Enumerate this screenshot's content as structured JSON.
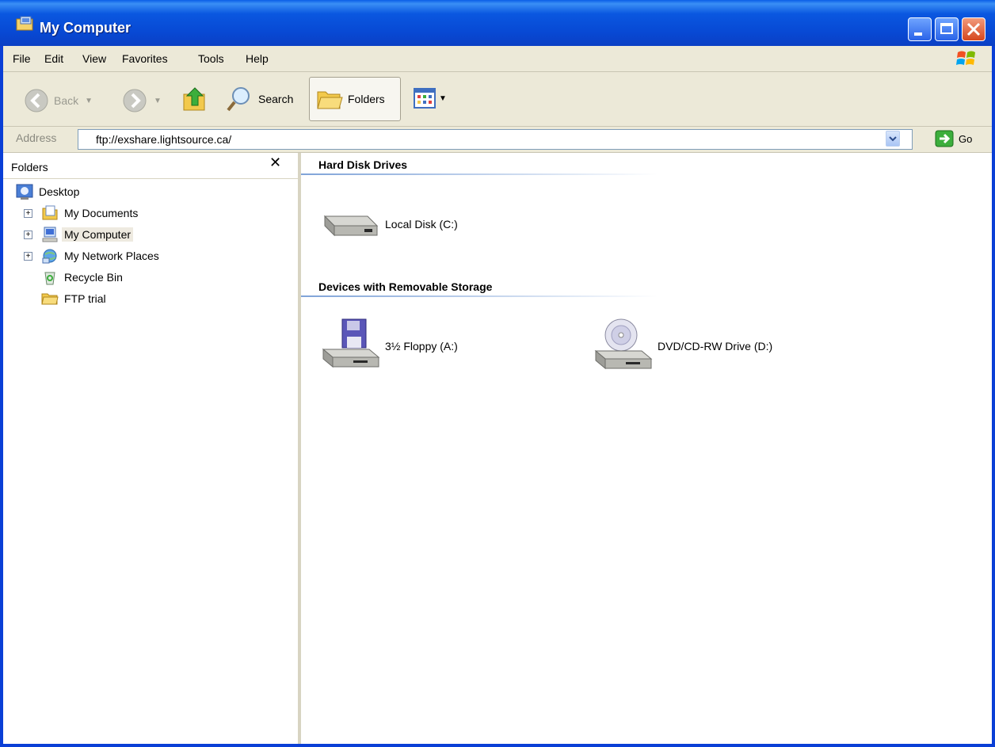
{
  "window": {
    "title": "My Computer"
  },
  "menu": {
    "file": "File",
    "edit": "Edit",
    "view": "View",
    "favorites": "Favorites",
    "tools": "Tools",
    "help": "Help"
  },
  "toolbar": {
    "back": "Back",
    "search": "Search",
    "folders": "Folders"
  },
  "address": {
    "label": "Address",
    "value": "ftp://exshare.lightsource.ca/",
    "go": "Go"
  },
  "folders_pane": {
    "title": "Folders",
    "items": [
      {
        "label": "Desktop"
      },
      {
        "label": "My Documents"
      },
      {
        "label": "My Computer"
      },
      {
        "label": "My Network Places"
      },
      {
        "label": "Recycle Bin"
      },
      {
        "label": "FTP trial"
      }
    ]
  },
  "groups": {
    "hard_disks": {
      "title": "Hard Disk Drives",
      "items": [
        {
          "label": "Local Disk (C:)"
        }
      ]
    },
    "removable": {
      "title": "Devices with Removable Storage",
      "items": [
        {
          "label": "3½ Floppy (A:)"
        },
        {
          "label": "DVD/CD-RW Drive (D:)"
        }
      ]
    }
  },
  "colors": {
    "title_bar": "#0a57e0",
    "chrome": "#ece9d8",
    "selection": "#eeeae0"
  }
}
